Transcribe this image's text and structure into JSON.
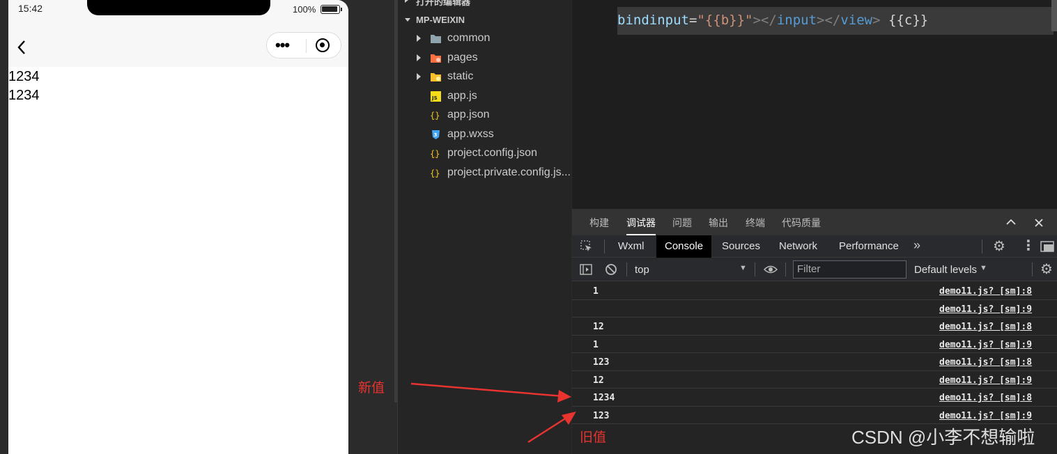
{
  "simulator": {
    "status_time": "15:42",
    "battery_percent": "100%",
    "battery_level": 1.0,
    "page_lines": [
      "1234",
      "1234"
    ]
  },
  "explorer": {
    "open_editors_label": "打开的编辑器",
    "project_label": "MP-WEIXIN",
    "items": [
      {
        "label": "common",
        "icon": "folder-icon",
        "expandable": true
      },
      {
        "label": "pages",
        "icon": "pages-folder-icon",
        "expandable": true
      },
      {
        "label": "static",
        "icon": "static-folder-icon",
        "expandable": true
      },
      {
        "label": "app.js",
        "icon": "js-file-icon",
        "expandable": false
      },
      {
        "label": "app.json",
        "icon": "json-file-icon",
        "expandable": false
      },
      {
        "label": "app.wxss",
        "icon": "css-file-icon",
        "expandable": false
      },
      {
        "label": "project.config.json",
        "icon": "json-file-icon",
        "expandable": false
      },
      {
        "label": "project.private.config.js...",
        "icon": "json-file-icon",
        "expandable": false
      }
    ]
  },
  "editor": {
    "code_parts": [
      {
        "text": "bindinput",
        "color": "#9cdcfe"
      },
      {
        "text": "=",
        "color": "#d4d4d4"
      },
      {
        "text": "\"{{b}}\"",
        "color": "#ce9178"
      },
      {
        "text": "></",
        "color": "#808080"
      },
      {
        "text": "input",
        "color": "#569cd6"
      },
      {
        "text": "></",
        "color": "#808080"
      },
      {
        "text": "view",
        "color": "#569cd6"
      },
      {
        "text": "> ",
        "color": "#808080"
      },
      {
        "text": "{{c}}",
        "color": "#d4d4d4"
      }
    ]
  },
  "devtools": {
    "panel_tabs": [
      "构建",
      "调试器",
      "问题",
      "输出",
      "终端",
      "代码质量"
    ],
    "active_panel_tab": "调试器",
    "tabs": [
      "Wxml",
      "Console",
      "Sources",
      "Network",
      "Performance"
    ],
    "active_tab": "Console",
    "more_tabs": "»",
    "context": "top",
    "filter_placeholder": "Filter",
    "levels": "Default levels",
    "logs": [
      {
        "value": "1",
        "source": "demo11.js? [sm]:8"
      },
      {
        "value": "",
        "source": "demo11.js? [sm]:9"
      },
      {
        "value": "12",
        "source": "demo11.js? [sm]:8"
      },
      {
        "value": "1",
        "source": "demo11.js? [sm]:9"
      },
      {
        "value": "123",
        "source": "demo11.js? [sm]:8"
      },
      {
        "value": "12",
        "source": "demo11.js? [sm]:9"
      },
      {
        "value": "1234",
        "source": "demo11.js? [sm]:8"
      },
      {
        "value": "123",
        "source": "demo11.js? [sm]:9"
      }
    ]
  },
  "annotations": {
    "new_value": "新值",
    "old_value": "旧值",
    "color": "#e8332f"
  },
  "watermark": "CSDN @小李不想输啦"
}
